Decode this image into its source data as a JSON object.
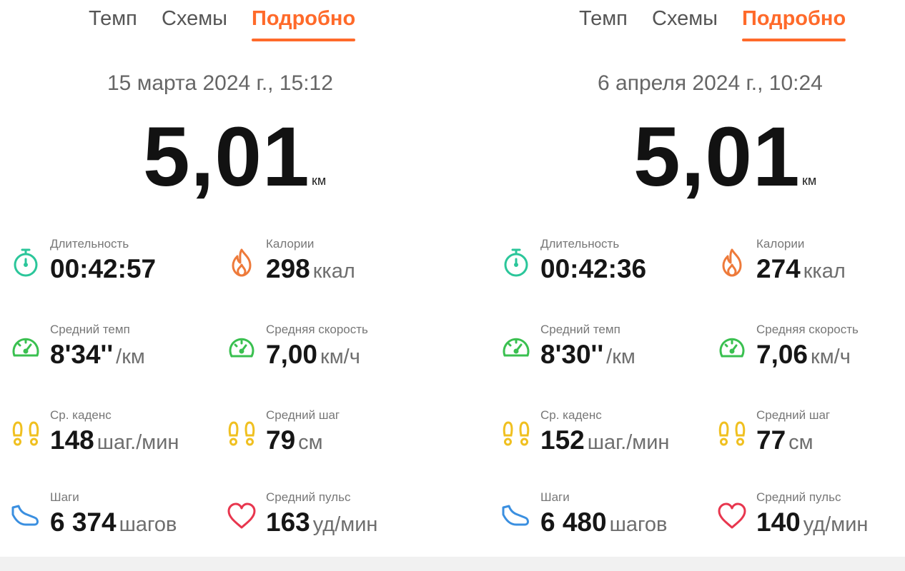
{
  "colors": {
    "accent": "#ff6a2a",
    "duration_icon": "#2bc69a",
    "calories_icon": "#ee7a3a",
    "pace_icon": "#3ac050",
    "cadence_icon": "#f0c020",
    "steps_icon": "#3a8fe0",
    "heart_icon": "#e8364e"
  },
  "left": {
    "tabs": {
      "pace": "Темп",
      "charts": "Схемы",
      "details": "Подробно"
    },
    "date": "15 марта 2024 г., 15:12",
    "distance": {
      "value": "5,01",
      "unit": "км"
    },
    "duration": {
      "label": "Длительность",
      "value": "00:42:57",
      "icon": "stopwatch-icon"
    },
    "calories": {
      "label": "Калории",
      "value": "298",
      "unit": "ккал",
      "icon": "flame-icon"
    },
    "avg_pace": {
      "label": "Средний темп",
      "value": "8'34''",
      "unit": "/км",
      "icon": "speedometer-icon"
    },
    "avg_speed": {
      "label": "Средняя скорость",
      "value": "7,00",
      "unit": "км/ч",
      "icon": "speedometer-icon"
    },
    "cadence": {
      "label": "Ср. каденс",
      "value": "148",
      "unit": "шаг./мин",
      "icon": "footprints-icon"
    },
    "avg_stride": {
      "label": "Средний шаг",
      "value": "79",
      "unit": "см",
      "icon": "footprints-icon"
    },
    "steps": {
      "label": "Шаги",
      "value": "6 374",
      "unit": "шагов",
      "icon": "shoe-icon"
    },
    "avg_hr": {
      "label": "Средний пульс",
      "value": "163",
      "unit": "уд/мин",
      "icon": "heart-icon"
    }
  },
  "right": {
    "tabs": {
      "pace": "Темп",
      "charts": "Схемы",
      "details": "Подробно"
    },
    "date": "6 апреля 2024 г., 10:24",
    "distance": {
      "value": "5,01",
      "unit": "км"
    },
    "duration": {
      "label": "Длительность",
      "value": "00:42:36",
      "icon": "stopwatch-icon"
    },
    "calories": {
      "label": "Калории",
      "value": "274",
      "unit": "ккал",
      "icon": "flame-icon"
    },
    "avg_pace": {
      "label": "Средний темп",
      "value": "8'30''",
      "unit": "/км",
      "icon": "speedometer-icon"
    },
    "avg_speed": {
      "label": "Средняя скорость",
      "value": "7,06",
      "unit": "км/ч",
      "icon": "speedometer-icon"
    },
    "cadence": {
      "label": "Ср. каденс",
      "value": "152",
      "unit": "шаг./мин",
      "icon": "footprints-icon"
    },
    "avg_stride": {
      "label": "Средний шаг",
      "value": "77",
      "unit": "см",
      "icon": "footprints-icon"
    },
    "steps": {
      "label": "Шаги",
      "value": "6 480",
      "unit": "шагов",
      "icon": "shoe-icon"
    },
    "avg_hr": {
      "label": "Средний пульс",
      "value": "140",
      "unit": "уд/мин",
      "icon": "heart-icon"
    }
  }
}
